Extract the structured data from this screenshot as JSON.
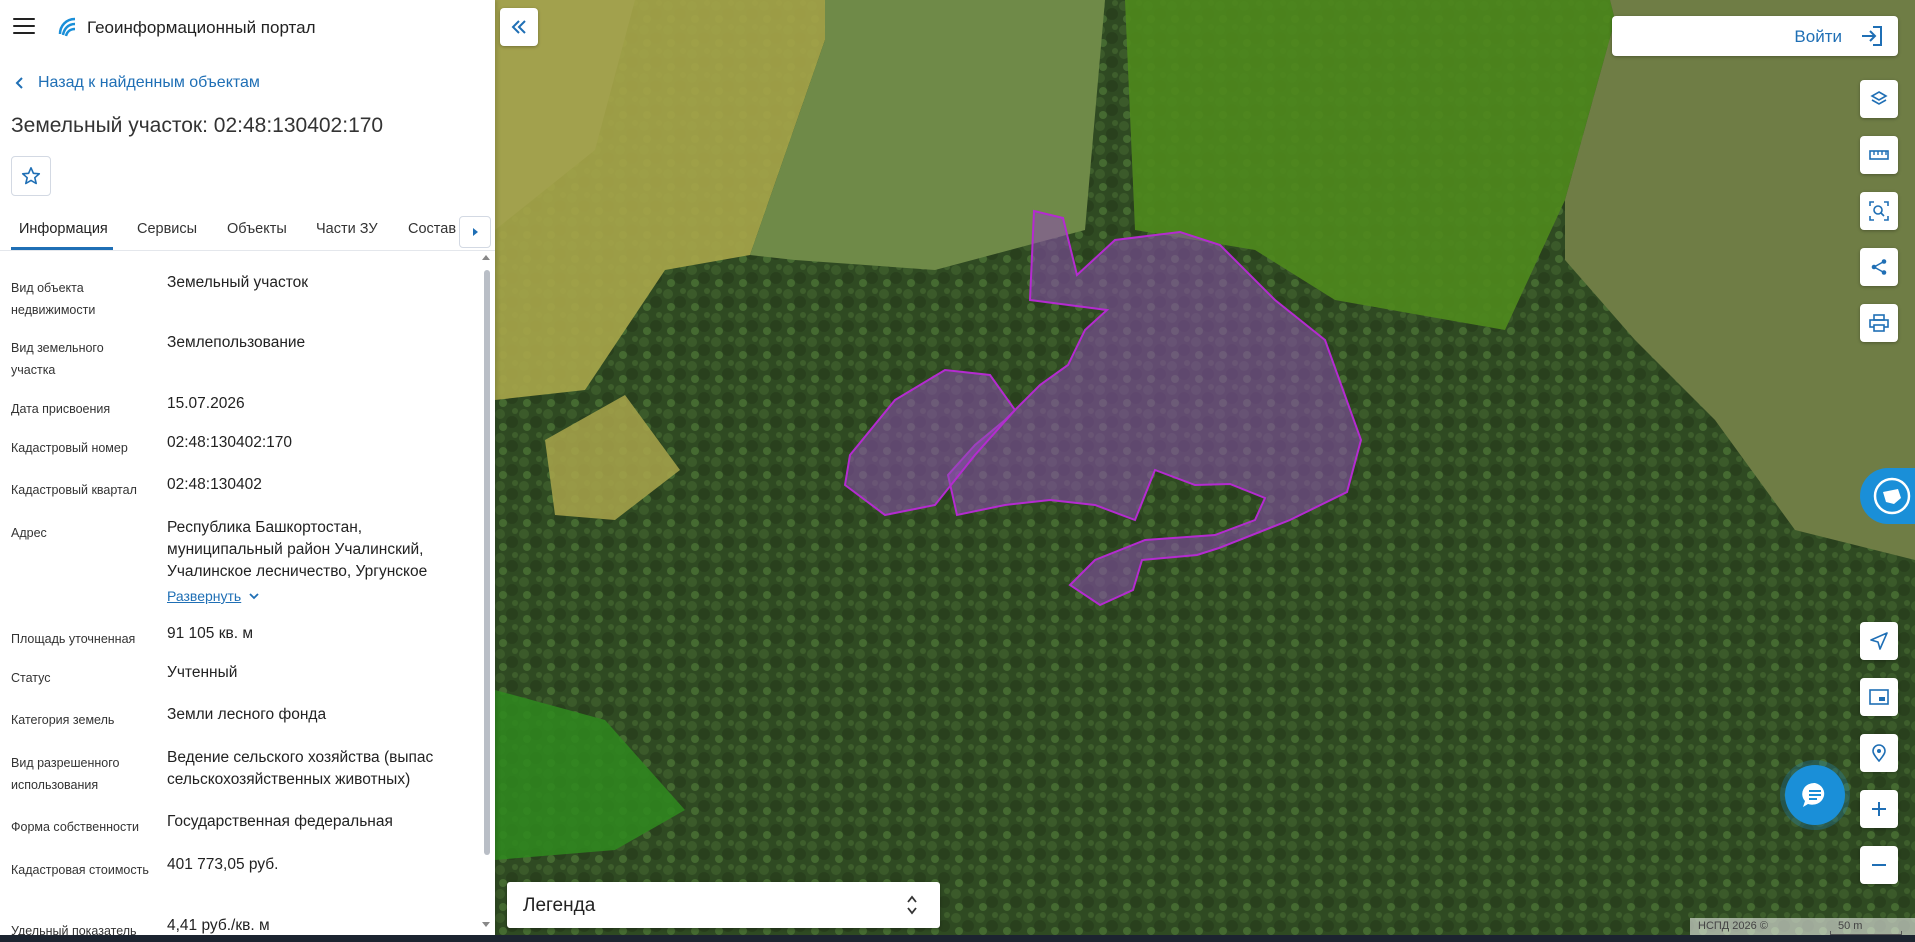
{
  "header": {
    "app_title": "Геоинформационный портал"
  },
  "back_link": "Назад к найденным объектам",
  "object_title": "Земельный участок: 02:48:130402:170",
  "tabs": [
    {
      "label": "Информация",
      "active": true
    },
    {
      "label": "Сервисы"
    },
    {
      "label": "Объекты"
    },
    {
      "label": "Части ЗУ"
    },
    {
      "label": "Состав"
    }
  ],
  "info": {
    "rows": [
      {
        "label": "Вид объекта недвижимости",
        "value": "Земельный участок"
      },
      {
        "label": "Вид земельного участка",
        "value": "Землепользование"
      },
      {
        "label": "Дата присвоения",
        "value": "15.07.2026"
      },
      {
        "label": "Кадастровый номер",
        "value": "02:48:130402:170"
      },
      {
        "label": "Кадастровый квартал",
        "value": "02:48:130402"
      },
      {
        "label": "Адрес",
        "value": "Республика Башкортостан, муниципальный район Учалинский, Учалинское лесничество, Ургунское"
      },
      {
        "label": "Площадь уточненная",
        "value": "91 105 кв. м"
      },
      {
        "label": "Статус",
        "value": "Учтенный"
      },
      {
        "label": "Категория земель",
        "value": "Земли лесного фонда"
      },
      {
        "label": "Вид разрешенного использования",
        "value": "Ведение сельского хозяйства (выпас сельскохозяйственных животных)"
      },
      {
        "label": "Форма собственности",
        "value": "Государственная федеральная"
      },
      {
        "label": "Кадастровая стоимость",
        "value": "401 773,05 руб."
      },
      {
        "label": "Удельный показатель",
        "value": "4,41 руб./кв. м"
      }
    ],
    "expand_label": "Развернуть"
  },
  "map": {
    "login_label": "Войти",
    "legend_label": "Легенда",
    "copyright": "НСПД 2026 ©",
    "scale_label": "50 m",
    "colors": {
      "accent": "#1f6fb5",
      "parcel_outline": "#b42bd0",
      "parcel_fill": "#8c4fb0"
    }
  }
}
